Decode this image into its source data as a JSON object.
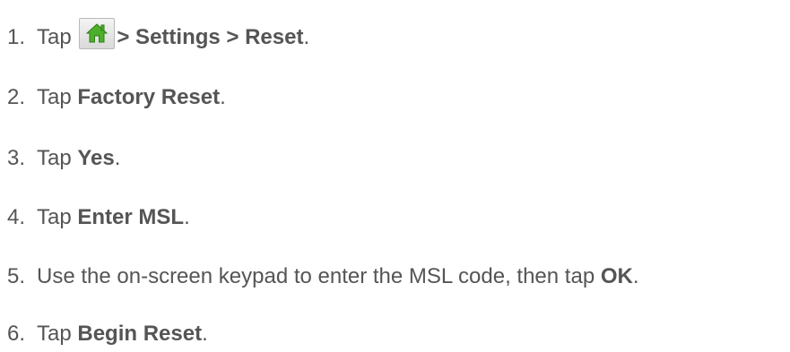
{
  "steps": [
    {
      "number": "1.",
      "text_before": "Tap ",
      "bold": "> Settings > Reset",
      "text_after": "."
    },
    {
      "number": "2.",
      "text_before": "Tap ",
      "bold": "Factory Reset",
      "text_after": "."
    },
    {
      "number": "3.",
      "text_before": "Tap ",
      "bold": "Yes",
      "text_after": "."
    },
    {
      "number": "4.",
      "text_before": "Tap ",
      "bold": "Enter MSL",
      "text_after": "."
    },
    {
      "number": "5.",
      "text_before": "Use the on-screen keypad to enter the MSL code, then tap ",
      "bold": "OK",
      "text_after": "."
    },
    {
      "number": "6.",
      "text_before": "Tap ",
      "bold": "Begin Reset",
      "text_after": "."
    }
  ],
  "icons": {
    "home": "home-icon",
    "home_color": "#4caf2a"
  }
}
